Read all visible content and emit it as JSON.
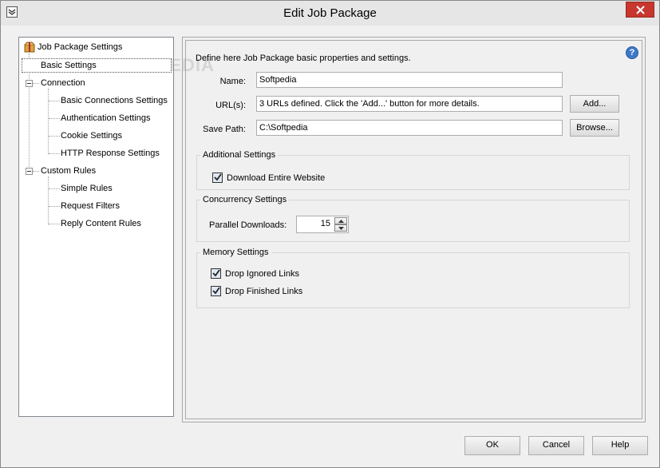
{
  "window": {
    "title": "Edit Job Package"
  },
  "watermark": "SOFTPEDIA",
  "tree": {
    "root": "Job Package Settings",
    "items": [
      {
        "label": "Basic Settings"
      },
      {
        "label": "Connection"
      },
      {
        "label": "Basic Connections Settings"
      },
      {
        "label": "Authentication Settings"
      },
      {
        "label": "Cookie Settings"
      },
      {
        "label": "HTTP Response Settings"
      },
      {
        "label": "Custom Rules"
      },
      {
        "label": "Simple Rules"
      },
      {
        "label": "Request Filters"
      },
      {
        "label": "Reply Content Rules"
      }
    ]
  },
  "main": {
    "description": "Define here Job Package basic properties and settings.",
    "help": "?",
    "name_label": "Name:",
    "name_value": "Softpedia",
    "urls_label": "URL(s):",
    "urls_value": "3 URLs defined. Click the 'Add...' button for more details.",
    "add_button": "Add...",
    "save_path_label": "Save Path:",
    "save_path_value": "C:\\Softpedia",
    "browse_button": "Browse...",
    "additional": {
      "title": "Additional Settings",
      "download_entire": "Download Entire Website",
      "download_entire_checked": true
    },
    "concurrency": {
      "title": "Concurrency Settings",
      "parallel_label": "Parallel Downloads:",
      "parallel_value": "15"
    },
    "memory": {
      "title": "Memory Settings",
      "drop_ignored": "Drop Ignored Links",
      "drop_ignored_checked": true,
      "drop_finished": "Drop Finished Links",
      "drop_finished_checked": true
    }
  },
  "footer": {
    "ok": "OK",
    "cancel": "Cancel",
    "help": "Help"
  },
  "colors": {
    "close": "#c7372f",
    "help_icon": "#3d78c8",
    "window_bg": "#f0f0f0"
  }
}
